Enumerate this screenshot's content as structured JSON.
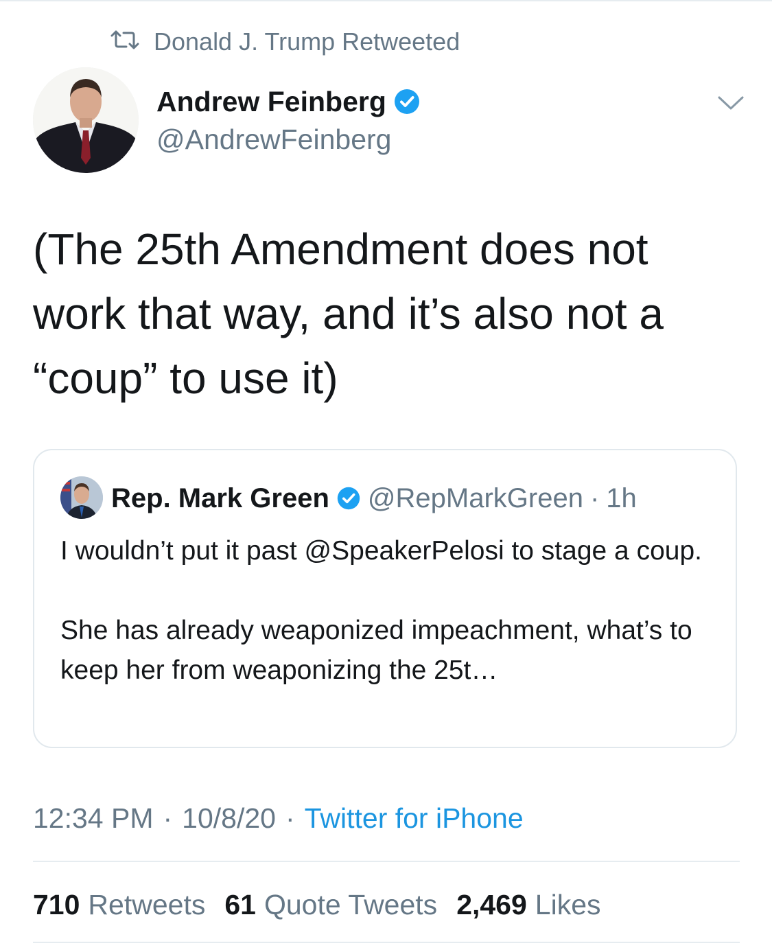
{
  "retweet_context": {
    "text": "Donald J. Trump Retweeted",
    "icon": "retweet-icon"
  },
  "author": {
    "name": "Andrew Feinberg",
    "handle": "@AndrewFeinberg",
    "verified": true,
    "avatar_icon": "profile-photo"
  },
  "tweet": {
    "text": "(The 25th Amendment does not\nwork that way, and it’s also not a\n“coup” to use it)"
  },
  "quoted_tweet": {
    "name": "Rep. Mark Green",
    "handle": "@RepMarkGreen",
    "separator": "·",
    "time": "1h",
    "paragraph1": "I wouldn’t put it past @SpeakerPelosi to stage a coup.",
    "paragraph2": "She has already weaponized impeachment, what’s to keep her from weaponizing the 25t…"
  },
  "meta": {
    "time": "12:34 PM",
    "sep1": "·",
    "date": "10/8/20",
    "sep2": "·",
    "source": "Twitter for iPhone"
  },
  "stats": {
    "retweets_count": "710",
    "retweets_label": "Retweets",
    "quotes_count": "61",
    "quotes_label": "Quote Tweets",
    "likes_count": "2,469",
    "likes_label": "Likes"
  },
  "colors": {
    "text": "#14171a",
    "secondary": "#657786",
    "link": "#1b95e0",
    "verified": "#1da1f2",
    "border": "#e1e8ed"
  }
}
